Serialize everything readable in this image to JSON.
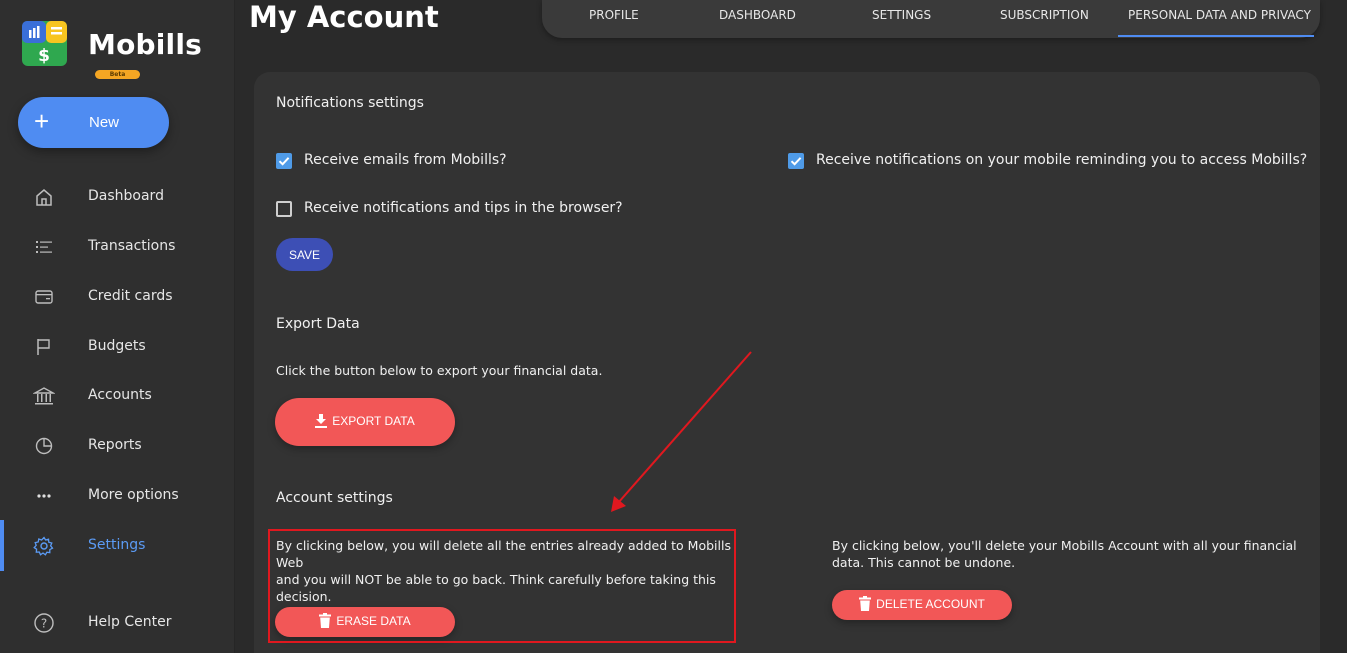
{
  "app": {
    "brand": "Mobills",
    "beta_badge": "Beta",
    "new_button_label": "New",
    "new_button_icon": "plus-icon"
  },
  "sidebar": {
    "items": [
      {
        "label": "Dashboard",
        "icon": "home-icon"
      },
      {
        "label": "Transactions",
        "icon": "list-icon"
      },
      {
        "label": "Credit cards",
        "icon": "credit-card-icon"
      },
      {
        "label": "Budgets",
        "icon": "flag-icon"
      },
      {
        "label": "Accounts",
        "icon": "bank-icon"
      },
      {
        "label": "Reports",
        "icon": "pie-chart-icon"
      },
      {
        "label": "More options",
        "icon": "more-icon"
      },
      {
        "label": "Settings",
        "icon": "gear-icon",
        "active": true
      },
      {
        "label": "Help Center",
        "icon": "help-icon"
      }
    ]
  },
  "header": {
    "title": "My Account",
    "tabs": [
      {
        "label": "PROFILE"
      },
      {
        "label": "DASHBOARD"
      },
      {
        "label": "SETTINGS"
      },
      {
        "label": "SUBSCRIPTION"
      },
      {
        "label": "PERSONAL DATA AND PRIVACY",
        "active": true
      }
    ]
  },
  "notifications": {
    "title": "Notifications settings",
    "emails_label": "Receive emails from Mobills?",
    "emails_checked": true,
    "mobile_label": "Receive notifications on your mobile reminding you to access Mobills?",
    "mobile_checked": true,
    "browser_label": "Receive notifications and tips in the browser?",
    "browser_checked": false,
    "save_label": "SAVE"
  },
  "export": {
    "title": "Export Data",
    "description": "Click the button below to export your financial data.",
    "button_label": "EXPORT DATA",
    "button_icon": "download-icon"
  },
  "account": {
    "title": "Account settings",
    "erase_description_line1": "By clicking below, you will delete all the entries already added to Mobills Web",
    "erase_description_line2": "and you will NOT be able to go back. Think carefully before taking this",
    "erase_description_line3": "decision.",
    "erase_button_label": "ERASE DATA",
    "delete_description_line1": "By clicking below, you'll delete your Mobills Account with all your financial",
    "delete_description_line2": "data. This cannot be undone.",
    "delete_button_label": "DELETE ACCOUNT",
    "button_icon": "trash-icon"
  },
  "colors": {
    "accent": "#4f8cf2",
    "danger": "#f25757",
    "save": "#3d4fb5",
    "annotation": "#e0181f"
  }
}
